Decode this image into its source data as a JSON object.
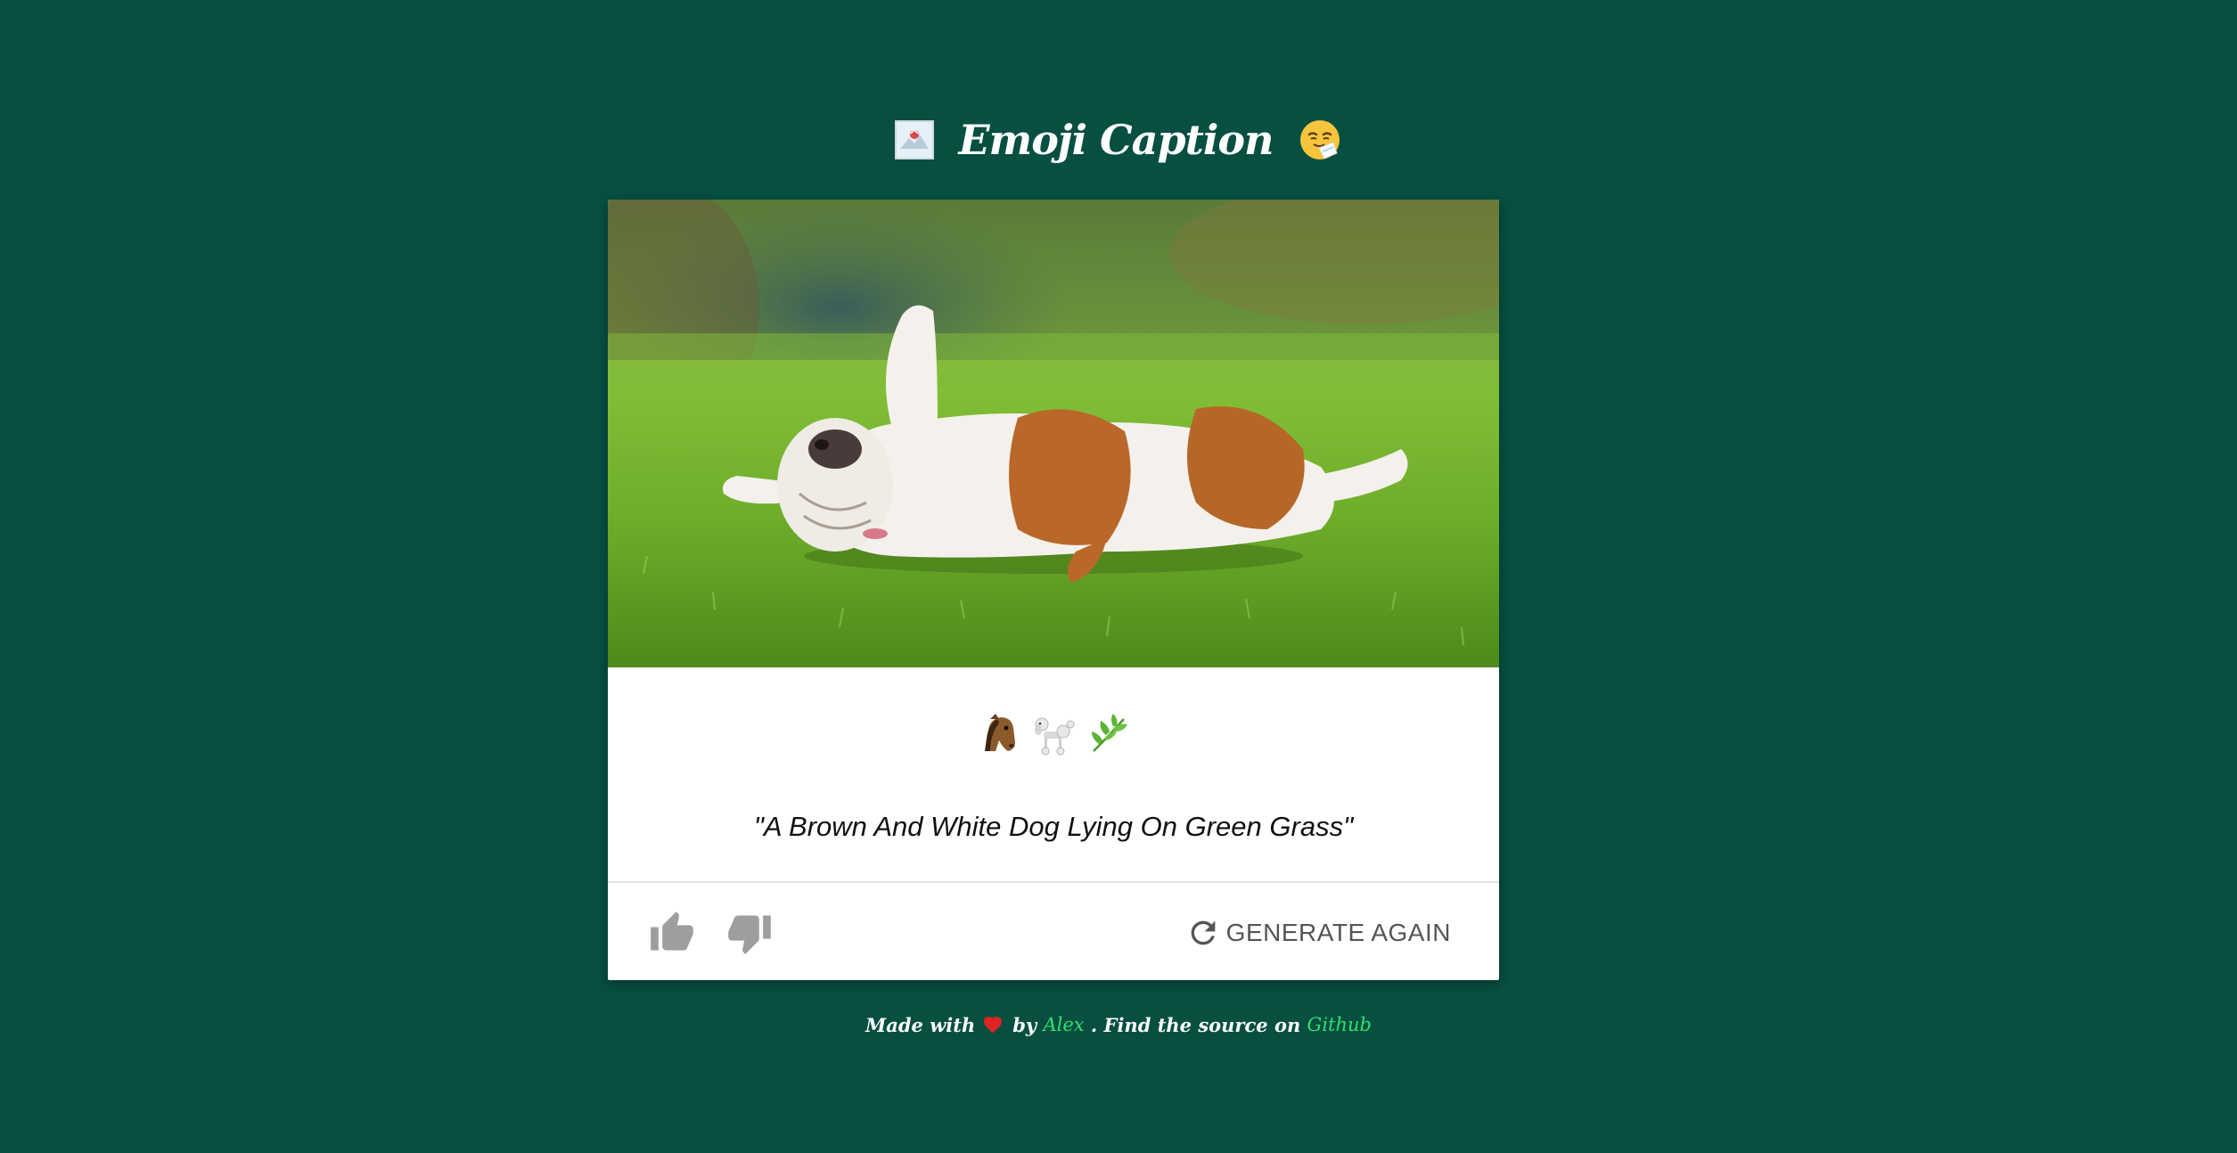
{
  "header": {
    "title": "Emoji Caption",
    "left_icon": "broken-image-icon",
    "right_icon": "sneezing-face-icon"
  },
  "card": {
    "photo_icon": "bulldog-rolling-on-grass",
    "emojis": [
      "horse-face-icon",
      "poodle-icon",
      "herb-icon"
    ],
    "caption": "\"A Brown And White Dog Lying On Green Grass\"",
    "actions": {
      "thumbs_up_icon": "thumbs-up-icon",
      "thumbs_down_icon": "thumbs-down-icon",
      "generate_label": "GENERATE AGAIN",
      "generate_icon": "refresh-icon"
    }
  },
  "footer": {
    "made_with": "Made with",
    "heart_icon": "heart-icon",
    "by": "by",
    "author": "Alex",
    "find_source": ". Find the source on",
    "source_link": "Github"
  },
  "colors": {
    "background": "#064f41",
    "link": "#2ee06b",
    "icon_grey": "#9e9e9e",
    "button_text": "#555555"
  }
}
